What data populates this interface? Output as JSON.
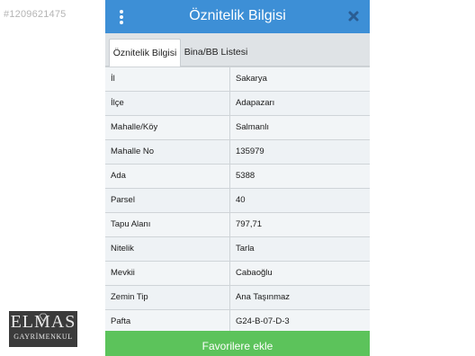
{
  "watermark": {
    "listing_id": "#1209621475"
  },
  "logo": {
    "main": "ELMAS",
    "sub": "GAYRİMENKUL"
  },
  "header": {
    "title": "Öznitelik Bilgisi",
    "menu_icon": "kebab-menu-icon",
    "close_icon": "close-icon"
  },
  "tabs": [
    {
      "label": "Öznitelik Bilgisi",
      "active": true
    },
    {
      "label": "Bina/BB Listesi",
      "active": false
    }
  ],
  "rows": [
    {
      "key": "İl",
      "value": "Sakarya"
    },
    {
      "key": "İlçe",
      "value": "Adapazarı"
    },
    {
      "key": "Mahalle/Köy",
      "value": "Salmanlı"
    },
    {
      "key": "Mahalle No",
      "value": "135979"
    },
    {
      "key": "Ada",
      "value": "5388"
    },
    {
      "key": "Parsel",
      "value": "40"
    },
    {
      "key": "Tapu Alanı",
      "value": "797,71"
    },
    {
      "key": "Nitelik",
      "value": "Tarla"
    },
    {
      "key": "Mevkii",
      "value": "Cabaoğlu"
    },
    {
      "key": "Zemin Tip",
      "value": "Ana Taşınmaz"
    },
    {
      "key": "Pafta",
      "value": "G24-B-07-D-3"
    }
  ],
  "footer": {
    "favorite_label": "Favorilere ekle"
  },
  "colors": {
    "header": "#3d8fd6",
    "button": "#5cc35b"
  }
}
